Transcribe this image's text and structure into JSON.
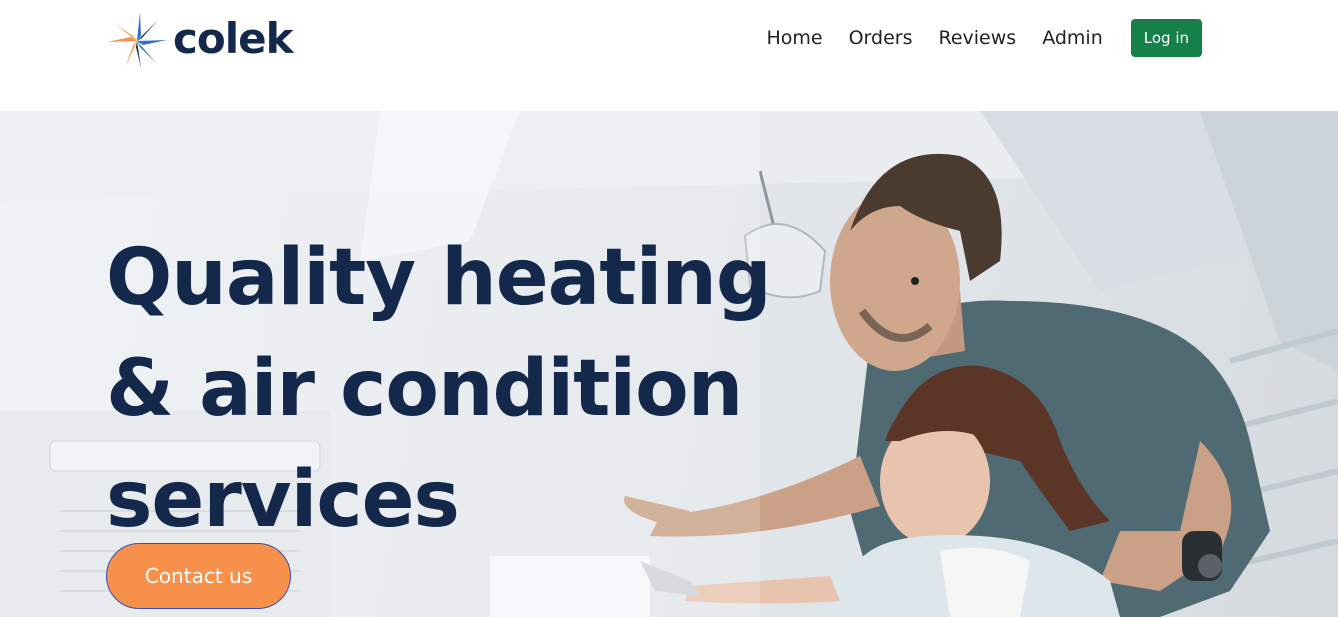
{
  "header": {
    "logo_text": "colek",
    "nav": {
      "home": "Home",
      "orders": "Orders",
      "reviews": "Reviews",
      "admin": "Admin"
    },
    "login_label": "Log in"
  },
  "hero": {
    "title_lines": [
      "Quality heating",
      "& air condition",
      "services"
    ],
    "cta_label": "Contact us"
  },
  "colors": {
    "brand_navy": "#14284b",
    "accent_orange": "#f7904a",
    "login_green": "#168049",
    "logo_blue": "#2f6fc8"
  }
}
